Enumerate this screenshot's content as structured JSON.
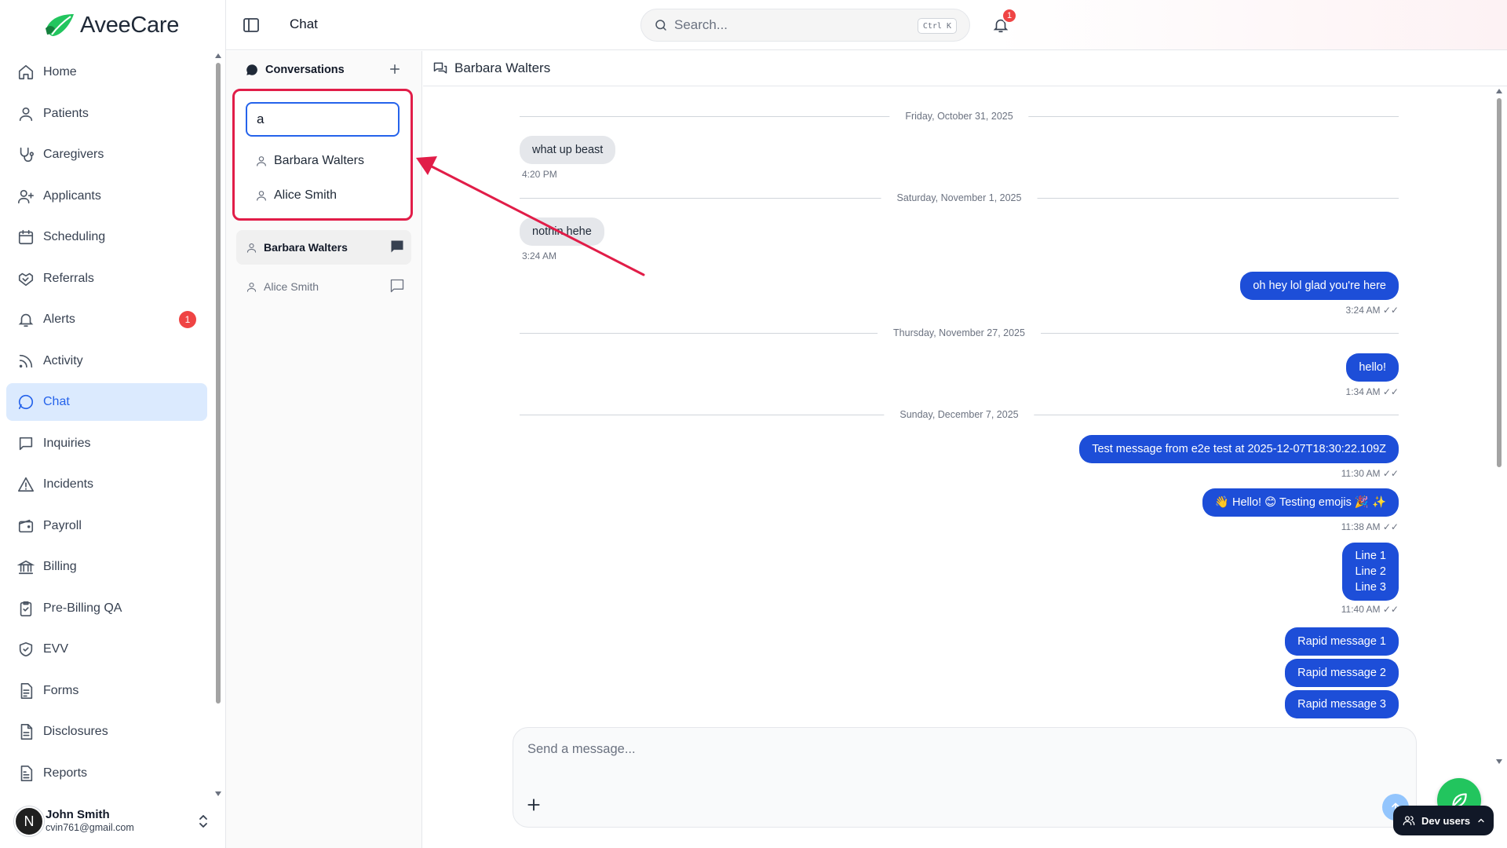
{
  "brand": {
    "name": "AveeCare",
    "accent": "#22c55e"
  },
  "sidebar": {
    "items": [
      {
        "label": "Home",
        "icon": "home-icon"
      },
      {
        "label": "Patients",
        "icon": "user-icon"
      },
      {
        "label": "Caregivers",
        "icon": "stethoscope-icon"
      },
      {
        "label": "Applicants",
        "icon": "user-plus-icon"
      },
      {
        "label": "Scheduling",
        "icon": "calendar-icon"
      },
      {
        "label": "Referrals",
        "icon": "handshake-icon"
      },
      {
        "label": "Alerts",
        "icon": "bell-icon",
        "badge": "1"
      },
      {
        "label": "Activity",
        "icon": "rss-icon"
      },
      {
        "label": "Chat",
        "icon": "message-circle-icon",
        "active": true
      },
      {
        "label": "Inquiries",
        "icon": "message-square-icon"
      },
      {
        "label": "Incidents",
        "icon": "alert-triangle-icon"
      },
      {
        "label": "Payroll",
        "icon": "wallet-icon"
      },
      {
        "label": "Billing",
        "icon": "landmark-icon"
      },
      {
        "label": "Pre-Billing QA",
        "icon": "clipboard-check-icon"
      },
      {
        "label": "EVV",
        "icon": "shield-check-icon"
      },
      {
        "label": "Forms",
        "icon": "file-text-icon"
      },
      {
        "label": "Disclosures",
        "icon": "file-icon"
      },
      {
        "label": "Reports",
        "icon": "file-lines-icon"
      }
    ],
    "user": {
      "initial": "N",
      "name": "John Smith",
      "email": "cvin761@gmail.com"
    }
  },
  "topbar": {
    "title": "Chat",
    "search_placeholder": "Search...",
    "search_shortcut": "Ctrl K",
    "notification_count": "1"
  },
  "conversations": {
    "title": "Conversations",
    "search_value": "a",
    "search_results": [
      "Barbara Walters",
      "Alice Smith"
    ],
    "list": [
      {
        "name": "Barbara Walters",
        "active": true
      },
      {
        "name": "Alice Smith",
        "active": false
      }
    ]
  },
  "chat": {
    "contact": "Barbara Walters",
    "dates": [
      "Friday, October 31, 2025",
      "Saturday, November 1, 2025",
      "Thursday, November 27, 2025",
      "Sunday, December 7, 2025"
    ],
    "messages": [
      {
        "text": "what up beast",
        "time": "4:20 PM",
        "dir": "in"
      },
      {
        "text": "nothin hehe",
        "time": "3:24 AM",
        "dir": "in"
      },
      {
        "text": "oh hey lol glad you're here",
        "time": "3:24 AM ✓✓",
        "dir": "out"
      },
      {
        "text": "hello!",
        "time": "1:34 AM ✓✓",
        "dir": "out"
      },
      {
        "text": "Test message from e2e test at 2025-12-07T18:30:22.109Z",
        "time": "11:30 AM ✓✓",
        "dir": "out"
      },
      {
        "text": "👋 Hello! 😊 Testing emojis 🎉 ✨",
        "time": "11:38 AM ✓✓",
        "dir": "out"
      },
      {
        "lines": [
          "Line 1",
          "Line 2",
          "Line 3"
        ],
        "time": "11:40 AM ✓✓",
        "dir": "out"
      },
      {
        "text": "Rapid message 1",
        "dir": "out"
      },
      {
        "text": "Rapid message 2",
        "dir": "out"
      },
      {
        "text": "Rapid message 3",
        "dir": "out"
      }
    ],
    "composer_placeholder": "Send a message..."
  },
  "dev": {
    "label": "Dev users"
  },
  "colors": {
    "active_nav_bg": "#dbeafe",
    "outgoing_bubble": "#1d4ed8",
    "highlight": "#e11d48",
    "badge": "#ef4444"
  }
}
